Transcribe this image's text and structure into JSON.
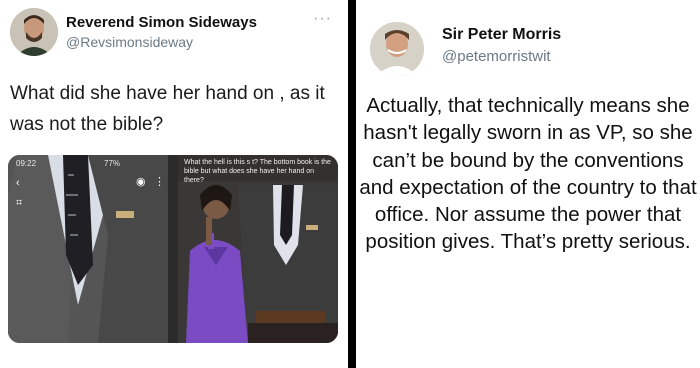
{
  "left_tweet": {
    "author_name": "Reverend Simon Sideways",
    "handle": "@Revsimonsideway",
    "more_label": "···",
    "text": "What did she have her hand on , as it was not the bible?",
    "media": {
      "screenshot_a": {
        "time": "09:22",
        "battery": "77%"
      },
      "screenshot_b": {
        "caption": "What the hell is this s   t? The bottom book is the bible but what does she have her hand on there?"
      }
    }
  },
  "right_tweet": {
    "author_name": "Sir Peter Morris",
    "handle": "@petemorristwit",
    "text": "Actually, that technically means she hasn't legally sworn in as VP, so she can’t be bound by the conventions and expectation of the country to that office. Nor assume the power that position gives. That’s pretty serious."
  },
  "colors": {
    "divider": "#000000",
    "handle": "#6b7a86",
    "purple_suit": "#7b4bc4"
  }
}
